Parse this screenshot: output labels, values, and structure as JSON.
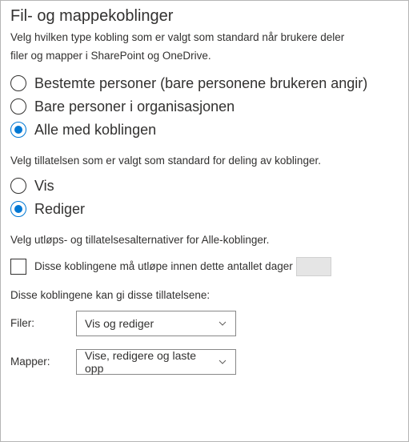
{
  "heading": "Fil- og mappekoblinger",
  "intro_line1": "Velg hvilken type kobling som er valgt som standard når brukere deler",
  "intro_line2": "filer og mapper i SharePoint og OneDrive.",
  "link_type": {
    "options": [
      {
        "label": "Bestemte personer (bare personene brukeren angir)",
        "selected": false
      },
      {
        "label": "Bare personer i organisasjonen",
        "selected": false
      },
      {
        "label": "Alle med koblingen",
        "selected": true
      }
    ]
  },
  "permission_intro": "Velg tillatelsen som er valgt som standard for deling av koblinger.",
  "permission": {
    "options": [
      {
        "label": "Vis",
        "selected": false
      },
      {
        "label": "Rediger",
        "selected": true
      }
    ]
  },
  "expiry_intro": "Velg utløps- og tillatelsesalternativer for Alle-koblinger.",
  "expiry_checkbox_label": "Disse koblingene må utløpe innen dette antallet dager",
  "permissions_label": "Disse koblingene kan gi disse tillatelsene:",
  "files_label": "Filer:",
  "folders_label": "Mapper:",
  "files_dropdown": "Vis og rediger",
  "folders_dropdown": "Vise, redigere og laste opp"
}
